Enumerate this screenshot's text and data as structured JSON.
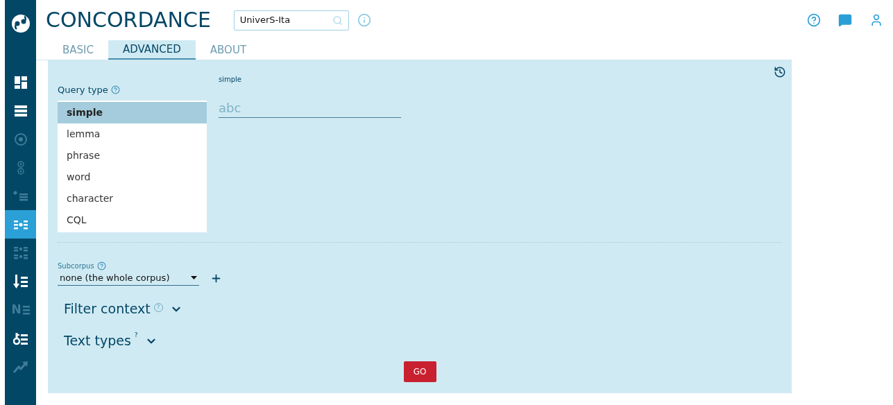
{
  "app": {
    "title": "CONCORDANCE",
    "corpus": "UniverS-Ita"
  },
  "sidebar": {
    "items": [
      {
        "kind": "dashboard",
        "selected": false,
        "disabled": false
      },
      {
        "kind": "rows",
        "selected": false,
        "disabled": false
      },
      {
        "kind": "target",
        "selected": false,
        "disabled": true
      },
      {
        "kind": "double-target",
        "selected": false,
        "disabled": true
      },
      {
        "kind": "dot-list",
        "selected": false,
        "disabled": true
      },
      {
        "kind": "dot-columns",
        "selected": true,
        "disabled": false
      },
      {
        "kind": "dot-grid",
        "selected": false,
        "disabled": true
      },
      {
        "kind": "sort",
        "selected": false,
        "disabled": false
      },
      {
        "kind": "letter-list",
        "glyph": "N",
        "selected": false,
        "disabled": true
      },
      {
        "kind": "key-list",
        "selected": false,
        "disabled": false
      },
      {
        "kind": "trend",
        "selected": false,
        "disabled": true
      }
    ]
  },
  "tabs": [
    {
      "label": "BASIC",
      "selected": false
    },
    {
      "label": "ADVANCED",
      "selected": true
    },
    {
      "label": "ABOUT",
      "selected": false
    }
  ],
  "query": {
    "label": "Query type",
    "options": [
      {
        "label": "simple",
        "selected": true
      },
      {
        "label": "lemma",
        "selected": false
      },
      {
        "label": "phrase",
        "selected": false
      },
      {
        "label": "word",
        "selected": false
      },
      {
        "label": "character",
        "selected": false
      },
      {
        "label": "CQL",
        "selected": false
      }
    ],
    "field_label": "simple",
    "placeholder": "abc"
  },
  "subcorpus": {
    "label": "Subcorpus",
    "value": "none (the whole corpus)"
  },
  "sections": [
    {
      "label": "Filter context",
      "help": "?",
      "expanded": false,
      "kind": "circle"
    },
    {
      "label": "Text types",
      "help": "?",
      "expanded": false,
      "kind": "superscript"
    }
  ],
  "go_button": "GO"
}
